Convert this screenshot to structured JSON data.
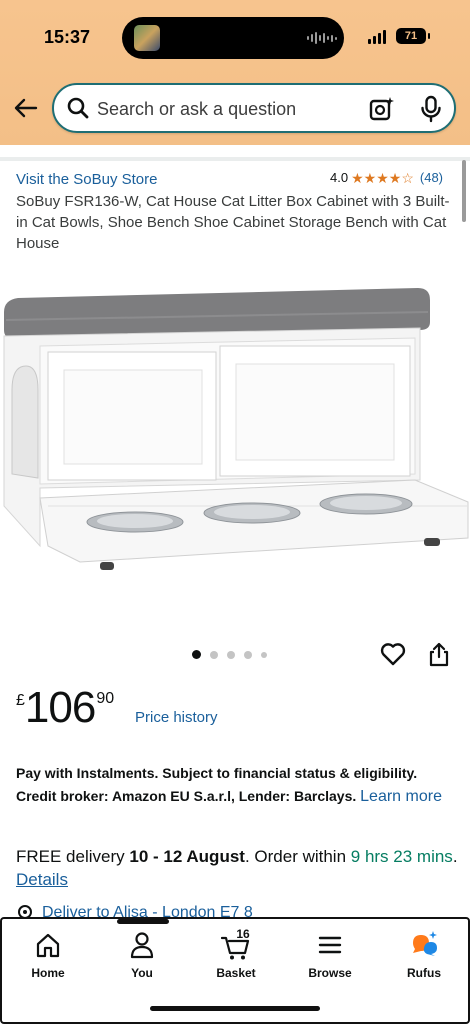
{
  "status": {
    "time": "15:37",
    "battery": "71"
  },
  "search": {
    "placeholder": "Search or ask a question"
  },
  "product": {
    "store_link": "Visit the SoBuy Store",
    "rating_value": "4.0",
    "rating_stars": 4,
    "rating_count": "(48)",
    "title": "SoBuy FSR136-W, Cat House Cat Litter Box Cabinet with 3 Built-in Cat Bowls, Shoe Bench Shoe Cabinet Storage Bench with Cat House"
  },
  "gallery": {
    "image_count": 5,
    "active_index": 0
  },
  "price": {
    "currency": "£",
    "whole": "106",
    "fraction": "90",
    "history_link": "Price history"
  },
  "instalments": {
    "text": "Pay with Instalments. Subject to financial status & eligibility. Credit broker: Amazon EU S.a.r.l, Lender: Barclays.",
    "learn_more": "Learn more"
  },
  "delivery": {
    "prefix": "FREE delivery ",
    "dates": "10 - 12 August",
    "middle": ". Order within ",
    "countdown": "9 hrs 23 mins",
    "suffix": ". ",
    "details_link": "Details"
  },
  "deliver_to": "Deliver to Alisa - London E7 8",
  "tabbar": {
    "home": "Home",
    "you": "You",
    "basket": "Basket",
    "basket_count": "16",
    "browse": "Browse",
    "rufus": "Rufus"
  },
  "colors": {
    "accent_link": "#1a5f9b",
    "star": "#de7921",
    "header": "#f3bf87",
    "green": "#067d62"
  },
  "icons": [
    "back-arrow-icon",
    "search-icon",
    "camera-icon",
    "microphone-icon",
    "heart-icon",
    "share-icon",
    "location-pin-icon",
    "home-icon",
    "person-icon",
    "cart-icon",
    "menu-icon",
    "rufus-icon"
  ]
}
